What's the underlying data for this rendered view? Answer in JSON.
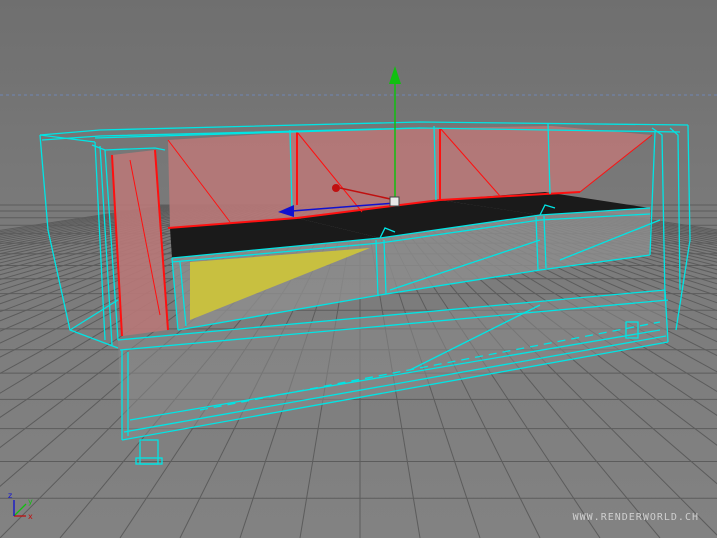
{
  "viewport": {
    "watermark": "WWW.RENDERWORLD.CH",
    "background_color": "#7a7a7a",
    "grid_color": "#5c5c5c",
    "wireframe_color": "#00e5e5",
    "selected_edge_color": "#ff1010",
    "backrest_face_color": "#b87878",
    "seat_top_color": "#111111",
    "highlight_face_color": "#c8c040",
    "horizon_line_color": "#6f86b5"
  },
  "transform_gizmo": {
    "y_axis_color": "#10c010",
    "x_axis_color": "#c01010",
    "z_axis_color": "#1010d0"
  },
  "axis_indicator": {
    "x_label": "x",
    "y_label": "y",
    "z_label": "z"
  }
}
